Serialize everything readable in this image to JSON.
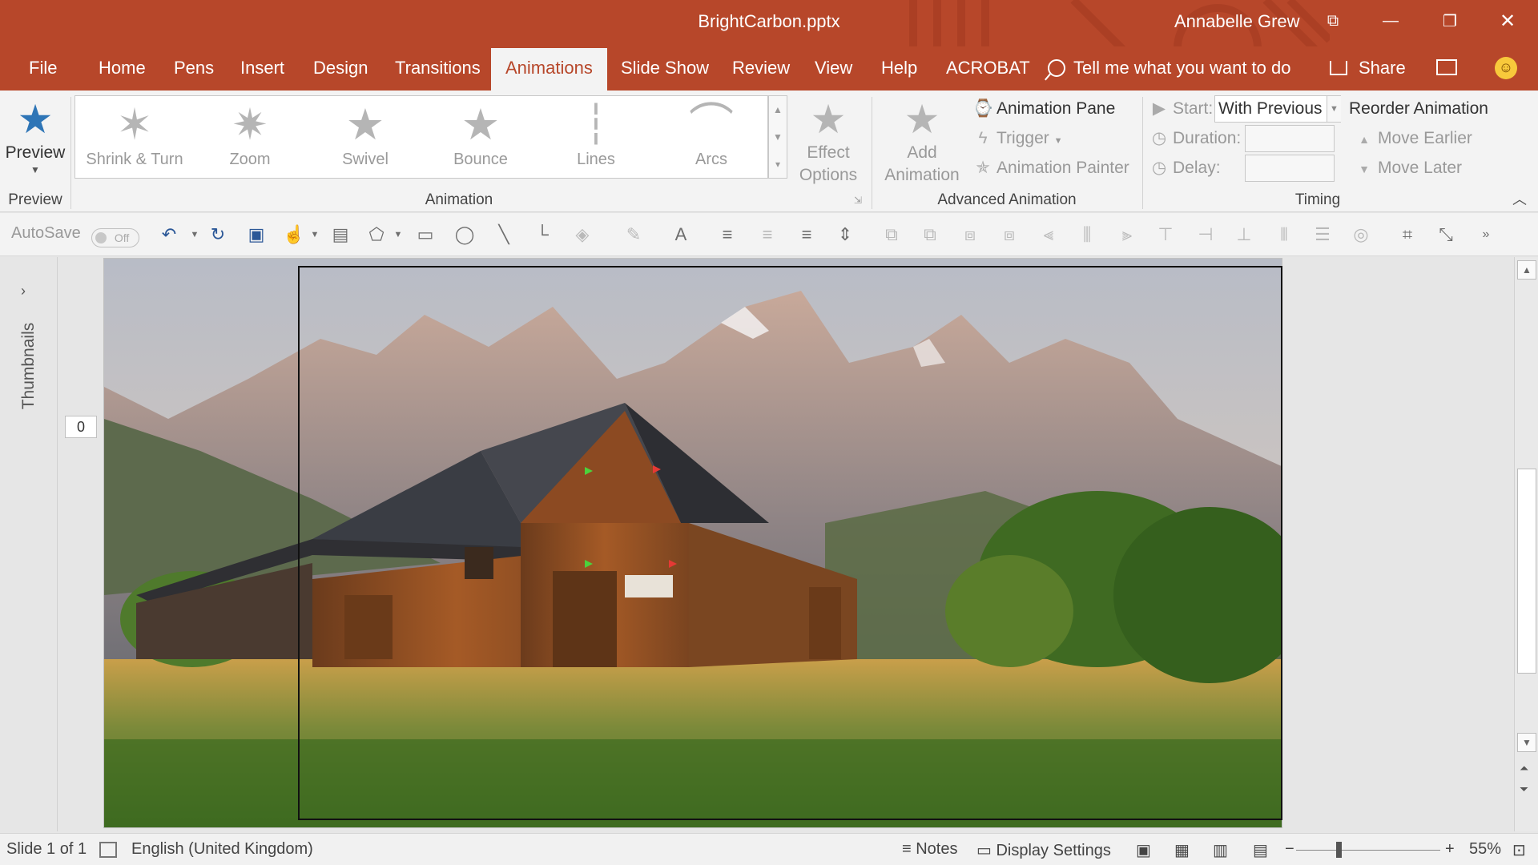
{
  "window": {
    "doc_title": "BrightCarbon.pptx",
    "user": "Annabelle Grew",
    "brand_color": "#b7472a"
  },
  "tabs": [
    "File",
    "Home",
    "Pens",
    "Insert",
    "Design",
    "Transitions",
    "Animations",
    "Slide Show",
    "Review",
    "View",
    "Help",
    "ACROBAT"
  ],
  "active_tab": "Animations",
  "tell_me": "Tell me what you want to do",
  "share": "Share",
  "ribbon": {
    "preview": {
      "label": "Preview",
      "group": "Preview"
    },
    "animation_group": "Animation",
    "gallery": [
      {
        "label": "Shrink & Turn",
        "icon": "star-shrink-icon"
      },
      {
        "label": "Zoom",
        "icon": "star-zoom-icon"
      },
      {
        "label": "Swivel",
        "icon": "star-swivel-icon"
      },
      {
        "label": "Bounce",
        "icon": "star-bounce-icon"
      },
      {
        "label": "Lines",
        "icon": "lines-path-icon"
      },
      {
        "label": "Arcs",
        "icon": "arcs-path-icon"
      }
    ],
    "effect_options": [
      "Effect",
      "Options"
    ],
    "add_animation": [
      "Add",
      "Animation"
    ],
    "animation_pane": "Animation Pane",
    "trigger": "Trigger",
    "animation_painter": "Animation Painter",
    "advanced_group": "Advanced Animation",
    "start_label": "Start:",
    "start_value": "With Previous",
    "duration_label": "Duration:",
    "delay_label": "Delay:",
    "reorder": "Reorder Animation",
    "move_earlier": "Move Earlier",
    "move_later": "Move Later",
    "timing_group": "Timing"
  },
  "qat": {
    "autosave": "AutoSave",
    "autosave_state": "Off"
  },
  "thumbnails_label": "Thumbnails",
  "slide_number_box": "0",
  "status": {
    "slide": "Slide 1 of 1",
    "language": "English (United Kingdom)",
    "notes": "Notes",
    "display_settings": "Display Settings",
    "zoom": "55%"
  }
}
